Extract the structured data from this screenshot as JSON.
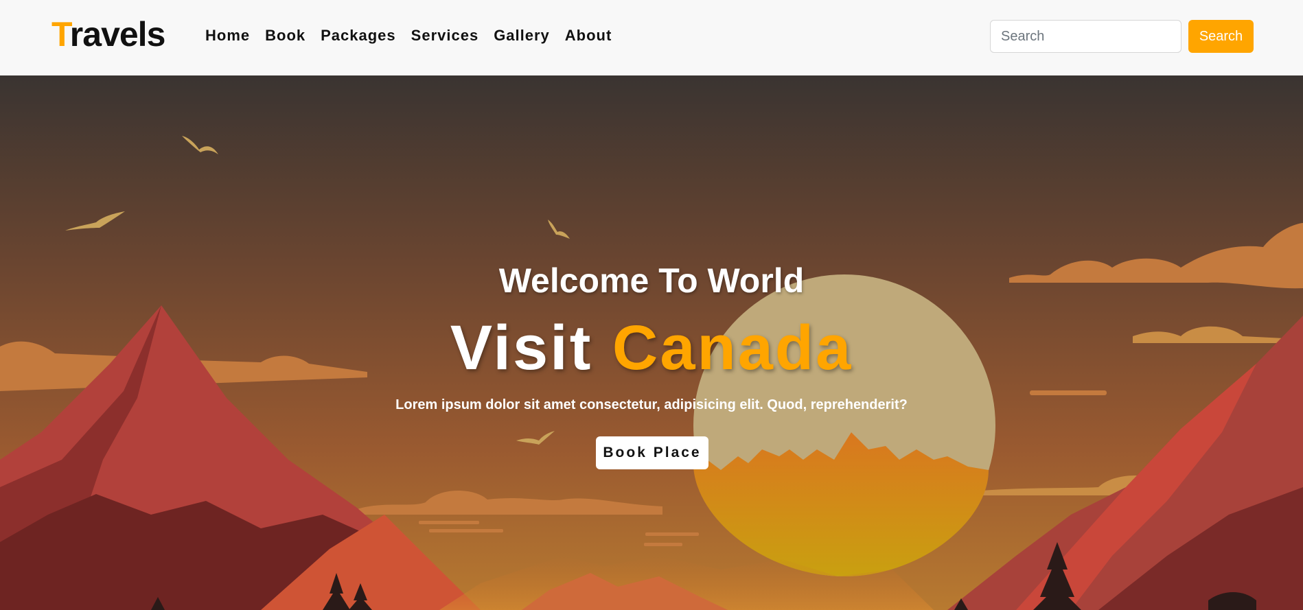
{
  "brand": {
    "first_letter": "T",
    "rest": "ravels"
  },
  "nav": {
    "items": [
      {
        "label": "Home"
      },
      {
        "label": "Book"
      },
      {
        "label": "Packages"
      },
      {
        "label": "Services"
      },
      {
        "label": "Gallery"
      },
      {
        "label": "About"
      }
    ]
  },
  "search": {
    "placeholder": "Search",
    "value": "",
    "button_label": "Search"
  },
  "hero": {
    "welcome": "Welcome To World",
    "headline_white": "Visit ",
    "headline_accent": "Canada",
    "subtext": "Lorem ipsum dolor sit amet consectetur, adipisicing elit. Quod, reprehenderit?",
    "button_label": "Book Place"
  },
  "colors": {
    "accent": "#ffa500",
    "navbar_bg": "#f8f8f8",
    "sky_top": "#3a3431",
    "sky_bottom": "#a9692f",
    "sun": "#bfa97a"
  },
  "icons": {
    "search_button": "none"
  }
}
